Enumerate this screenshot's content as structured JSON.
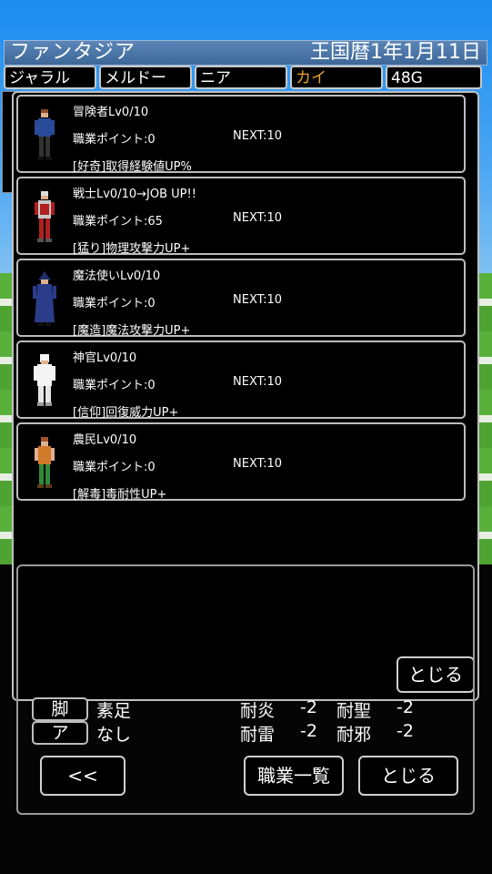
{
  "header": {
    "game_title": "ファンタジア",
    "date": "王国暦1年1月11日"
  },
  "party_tabs": [
    {
      "label": "ジャラル",
      "active": false
    },
    {
      "label": "メルドー",
      "active": false
    },
    {
      "label": "ニア",
      "active": false
    },
    {
      "label": "カイ",
      "active": true
    }
  ],
  "gold": "48G",
  "jobs": [
    {
      "name": "冒険者Lv0/10",
      "points": "職業ポイント:0",
      "next": "NEXT:10",
      "skill": "[好奇]取得経験値UP%",
      "sprite": "adventurer-sprite"
    },
    {
      "name": "戦士Lv0/10→JOB UP!!",
      "points": "職業ポイント:65",
      "next": "NEXT:10",
      "skill": "[猛り]物理攻撃力UP+",
      "sprite": "warrior-sprite"
    },
    {
      "name": "魔法使いLv0/10",
      "points": "職業ポイント:0",
      "next": "NEXT:10",
      "skill": "[魔造]魔法攻撃力UP+",
      "sprite": "mage-sprite"
    },
    {
      "name": "神官Lv0/10",
      "points": "職業ポイント:0",
      "next": "NEXT:10",
      "skill": "[信仰]回復威力UP+",
      "sprite": "priest-sprite"
    },
    {
      "name": "農民Lv0/10",
      "points": "職業ポイント:0",
      "next": "NEXT:10",
      "skill": "[解毒]毒耐性UP+",
      "sprite": "farmer-sprite"
    }
  ],
  "job_panel_close": "とじる",
  "equip": {
    "rows": [
      {
        "slot": "脚",
        "item": "素足",
        "res1_label": "耐炎",
        "res1_value": "-2",
        "res2_label": "耐聖",
        "res2_value": "-2"
      },
      {
        "slot": "ア",
        "item": "なし",
        "res1_label": "耐雷",
        "res1_value": "-2",
        "res2_label": "耐邪",
        "res2_value": "-2"
      }
    ],
    "back_label": "<<",
    "job_list_label": "職業一覧",
    "close_label": "とじる"
  },
  "colors": {
    "active_tab": "#e8a32a",
    "title_bar": "#4a75a8",
    "sky": "#1b8cf0",
    "grass": "#58b03a"
  }
}
